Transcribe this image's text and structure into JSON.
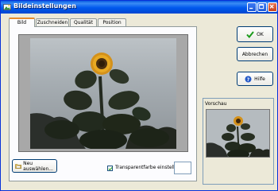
{
  "window": {
    "title": "Bildeinstellungen"
  },
  "tabs": [
    {
      "label": "Bild",
      "active": true
    },
    {
      "label": "Zuschneiden",
      "active": false
    },
    {
      "label": "Qualität",
      "active": false
    },
    {
      "label": "Position",
      "active": false
    }
  ],
  "buttons": {
    "ok": "OK",
    "cancel": "Abbrechen",
    "help": "Hilfe",
    "choose_new": "Neu auswählen..."
  },
  "checkbox": {
    "label": "Transparentfarbe einstellen",
    "checked": true
  },
  "preview": {
    "label": "Vorschau"
  },
  "icons": {
    "app": "image-icon",
    "ok": "checkmark-icon",
    "help": "question-icon",
    "choose": "folder-icon"
  },
  "colors": {
    "titlebar": "#0058ee",
    "tab_highlight": "#e68b2c",
    "ok_check": "#1a9a1a"
  }
}
